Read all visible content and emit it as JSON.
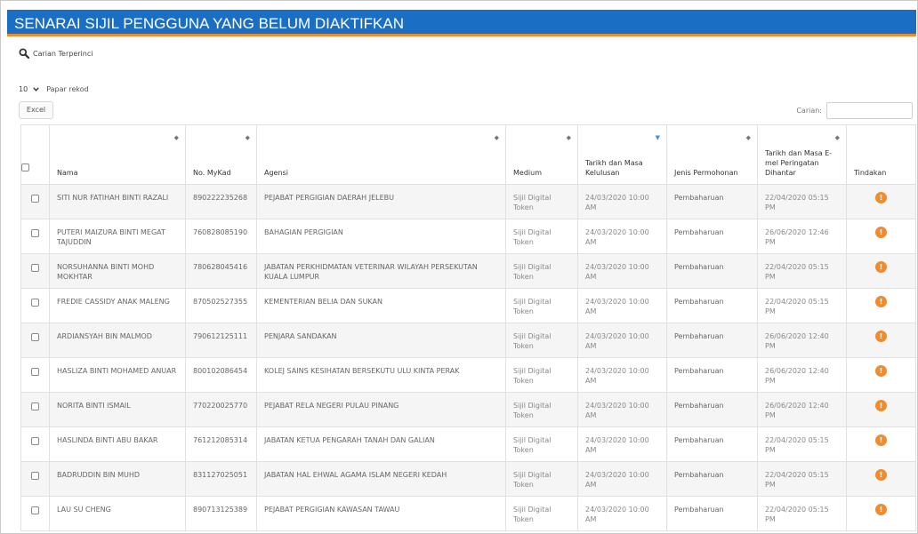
{
  "page": {
    "title": "SENARAI SIJIL PENGGUNA YANG BELUM DIAKTIFKAN",
    "advanced_search_label": "Carian Terperinci",
    "page_length_value": "10",
    "page_length_label": "Papar rekod",
    "excel_label": "Excel",
    "filter_label": "Carian:",
    "filter_value": ""
  },
  "colors": {
    "title_bar": "#1a6fc4",
    "accent": "#f08c2e"
  },
  "table": {
    "columns": [
      {
        "label": "Nama"
      },
      {
        "label": "No. MyKad"
      },
      {
        "label": "Agensi"
      },
      {
        "label": "Medium"
      },
      {
        "label": "Tarikh dan Masa Kelulusan"
      },
      {
        "label": "Jenis Permohonan"
      },
      {
        "label": "Tarikh dan Masa E-mel Peringatan Dihantar"
      },
      {
        "label": "Tindakan"
      }
    ],
    "rows": [
      {
        "nama": "SITI NUR FATIHAH BINTI RAZALI",
        "mykad": "890222235268",
        "agensi": "PEJABAT PERGIGIAN DAERAH JELEBU",
        "medium": "Sijil Digital Token",
        "kelulusan": "24/03/2020 10:00 AM",
        "jenis": "Pembaharuan",
        "emel": "22/04/2020 05:15 PM"
      },
      {
        "nama": "PUTERI MAIZURA BINTI MEGAT TAJUDDIN",
        "mykad": "760828085190",
        "agensi": "BAHAGIAN PERGIGIAN",
        "medium": "Sijil Digital Token",
        "kelulusan": "24/03/2020 10:00 AM",
        "jenis": "Pembaharuan",
        "emel": "26/06/2020 12:46 PM"
      },
      {
        "nama": "NORSUHANNA BINTI MOHD MOKHTAR",
        "mykad": "780628045416",
        "agensi": "JABATAN PERKHIDMATAN VETERINAR WILAYAH PERSEKUTAN KUALA LUMPUR",
        "medium": "Sijil Digital Token",
        "kelulusan": "24/03/2020 10:00 AM",
        "jenis": "Pembaharuan",
        "emel": "22/04/2020 05:15 PM"
      },
      {
        "nama": "FREDIE CASSIDY ANAK MALENG",
        "mykad": "870502527355",
        "agensi": "KEMENTERIAN BELIA DAN SUKAN",
        "medium": "Sijil Digital Token",
        "kelulusan": "24/03/2020 10:00 AM",
        "jenis": "Pembaharuan",
        "emel": "22/04/2020 05:15 PM"
      },
      {
        "nama": "ARDIANSYAH BIN MALMOD",
        "mykad": "790612125111",
        "agensi": "PENJARA SANDAKAN",
        "medium": "Sijil Digital Token",
        "kelulusan": "24/03/2020 10:00 AM",
        "jenis": "Pembaharuan",
        "emel": "26/06/2020 12:40 PM"
      },
      {
        "nama": "HASLIZA BINTI MOHAMED ANUAR",
        "mykad": "800102086454",
        "agensi": "KOLEJ SAINS KESIHATAN BERSEKUTU ULU KINTA PERAK",
        "medium": "Sijil Digital Token",
        "kelulusan": "24/03/2020 10:00 AM",
        "jenis": "Pembaharuan",
        "emel": "26/06/2020 12:40 PM"
      },
      {
        "nama": "NORITA BINTI ISMAIL",
        "mykad": "770220025770",
        "agensi": "PEJABAT RELA NEGERI PULAU PINANG",
        "medium": "Sijil Digital Token",
        "kelulusan": "24/03/2020 10:00 AM",
        "jenis": "Pembaharuan",
        "emel": "26/06/2020 12:40 PM"
      },
      {
        "nama": "HASLINDA BINTI ABU BAKAR",
        "mykad": "761212085314",
        "agensi": "JABATAN KETUA PENGARAH TANAH DAN GALIAN",
        "medium": "Sijil Digital Token",
        "kelulusan": "24/03/2020 10:00 AM",
        "jenis": "Pembaharuan",
        "emel": "22/04/2020 05:15 PM"
      },
      {
        "nama": "BADRUDDIN BIN MUHD",
        "mykad": "831127025051",
        "agensi": "JABATAN HAL EHWAL AGAMA ISLAM NEGERI KEDAH",
        "medium": "Sijil Digital Token",
        "kelulusan": "24/03/2020 10:00 AM",
        "jenis": "Pembaharuan",
        "emel": "22/04/2020 05:15 PM"
      },
      {
        "nama": "LAU SU CHENG",
        "mykad": "890713125389",
        "agensi": "PEJABAT PERGIGIAN KAWASAN TAWAU",
        "medium": "Sijil Digital Token",
        "kelulusan": "24/03/2020 10:00 AM",
        "jenis": "Pembaharuan",
        "emel": "22/04/2020 05:15 PM"
      }
    ]
  }
}
